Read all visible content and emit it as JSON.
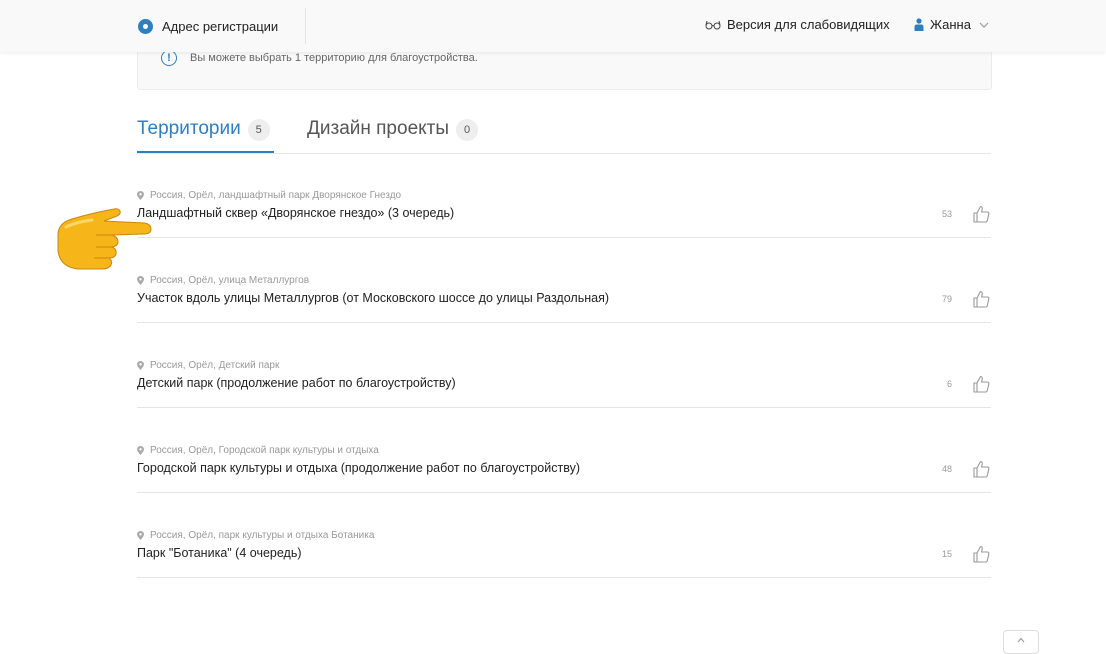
{
  "header": {
    "address_label": "Адрес регистрации",
    "vision_label": "Версия для слабовидящих",
    "user_name": "Жанна"
  },
  "notice": {
    "icon": "!",
    "text": "Вы можете выбрать 1 территорию для благоустройства."
  },
  "tabs": [
    {
      "label": "Территории",
      "count": "5",
      "active": true
    },
    {
      "label": "Дизайн проекты",
      "count": "0",
      "active": false
    }
  ],
  "items": [
    {
      "location": "Россия, Орёл, ландшафтный парк Дворянское Гнездо",
      "title": "Ландшафтный сквер «Дворянское гнездо» (3 очередь)",
      "votes": "53"
    },
    {
      "location": "Россия, Орёл, улица Металлургов",
      "title": "Участок вдоль улицы Металлургов (от Московского шоссе до улицы Раздольная)",
      "votes": "79"
    },
    {
      "location": "Россия, Орёл, Детский парк",
      "title": "Детский парк (продолжение работ по благоустройству)",
      "votes": "6"
    },
    {
      "location": "Россия, Орёл, Городской парк культуры и отдыха",
      "title": "Городской парк культуры и отдыха (продолжение работ по благоустройству)",
      "votes": "48"
    },
    {
      "location": "Россия, Орёл, парк культуры и отдыха Ботаника",
      "title": "Парк \"Ботаника\" (4 очередь)",
      "votes": "15"
    }
  ],
  "colors": {
    "accent": "#2d7fc0",
    "pointer_hand": "#f6b619"
  },
  "icons": [
    "radio-icon",
    "glasses-icon",
    "person-icon",
    "chevron-down-icon",
    "info-icon",
    "location-pin-icon",
    "thumbs-up-icon",
    "pointing-hand-icon",
    "arrow-up-icon"
  ]
}
